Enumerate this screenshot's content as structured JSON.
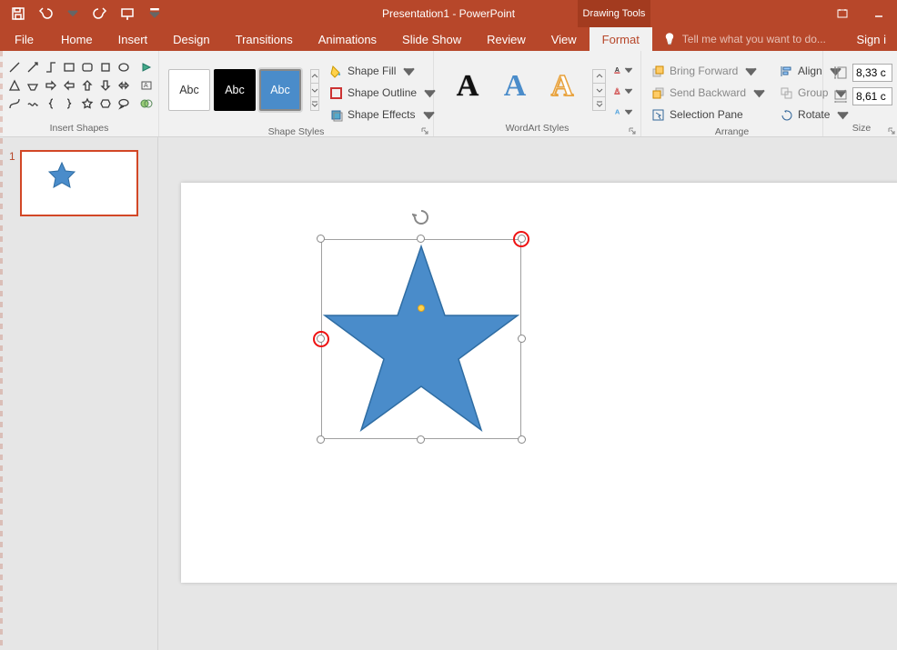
{
  "title": "Presentation1 - PowerPoint",
  "contextual_tab": "Drawing Tools",
  "qat": {
    "save": "Save",
    "undo": "Undo",
    "redo": "Redo",
    "startfrom": "Start From Beginning"
  },
  "tabs": {
    "file": "File",
    "home": "Home",
    "insert": "Insert",
    "design": "Design",
    "transitions": "Transitions",
    "animations": "Animations",
    "slideshow": "Slide Show",
    "review": "Review",
    "view": "View",
    "format": "Format"
  },
  "tellme": "Tell me what you want to do...",
  "signin": "Sign i",
  "groups": {
    "insert_shapes": "Insert Shapes",
    "shape_styles": "Shape Styles",
    "wordart_styles": "WordArt Styles",
    "arrange": "Arrange",
    "size": "Size"
  },
  "shape_styles": {
    "abc1": "Abc",
    "abc2": "Abc",
    "abc3": "Abc",
    "fill": "Shape Fill",
    "outline": "Shape Outline",
    "effects": "Shape Effects"
  },
  "wordart": {
    "a1": "A",
    "a2": "A",
    "a3": "A"
  },
  "arrange": {
    "bring_forward": "Bring Forward",
    "send_backward": "Send Backward",
    "selection_pane": "Selection Pane",
    "align": "Align",
    "group": "Group",
    "rotate": "Rotate"
  },
  "size": {
    "height": "8,33 c",
    "width": "8,61 c"
  },
  "thumb": {
    "num": "1"
  }
}
